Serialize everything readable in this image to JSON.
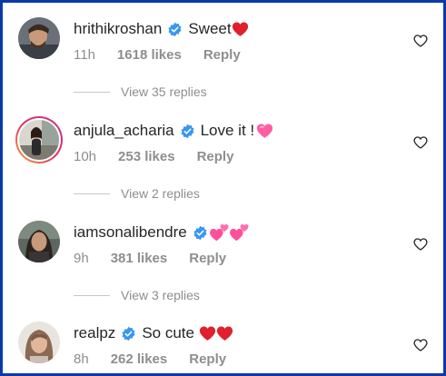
{
  "comments": [
    {
      "username": "hrithikroshan",
      "text": "Sweet",
      "emoji": [
        "red-heart"
      ],
      "time": "11h",
      "likes": "1618 likes",
      "reply": "Reply",
      "view_replies": "View 35 replies",
      "avatar": "avatar-hrithik"
    },
    {
      "username": "anjula_acharia",
      "text": "Love it !",
      "emoji": [
        "pink-heart"
      ],
      "time": "10h",
      "likes": "253 likes",
      "reply": "Reply",
      "view_replies": "View 2 replies",
      "avatar": "avatar-anjula"
    },
    {
      "username": "iamsonalibendre",
      "text": "",
      "emoji": [
        "two-hearts",
        "two-hearts"
      ],
      "time": "9h",
      "likes": "381 likes",
      "reply": "Reply",
      "view_replies": "View 3 replies",
      "avatar": "avatar-sonali"
    },
    {
      "username": "realpz",
      "text": "So cute",
      "emoji": [
        "red-heart",
        "red-heart"
      ],
      "time": "8h",
      "likes": "262 likes",
      "reply": "Reply",
      "view_replies": "",
      "avatar": "avatar-realpz"
    }
  ],
  "icons": {
    "verified": "verified-badge-icon",
    "like": "heart-outline-icon"
  },
  "colors": {
    "frame_border": "#0b3aa8",
    "verified_blue": "#3897f0",
    "muted_text": "#8e8e8e",
    "primary_text": "#262626",
    "red_heart": "#e0202e",
    "pink_heart": "#ff5fa2"
  }
}
